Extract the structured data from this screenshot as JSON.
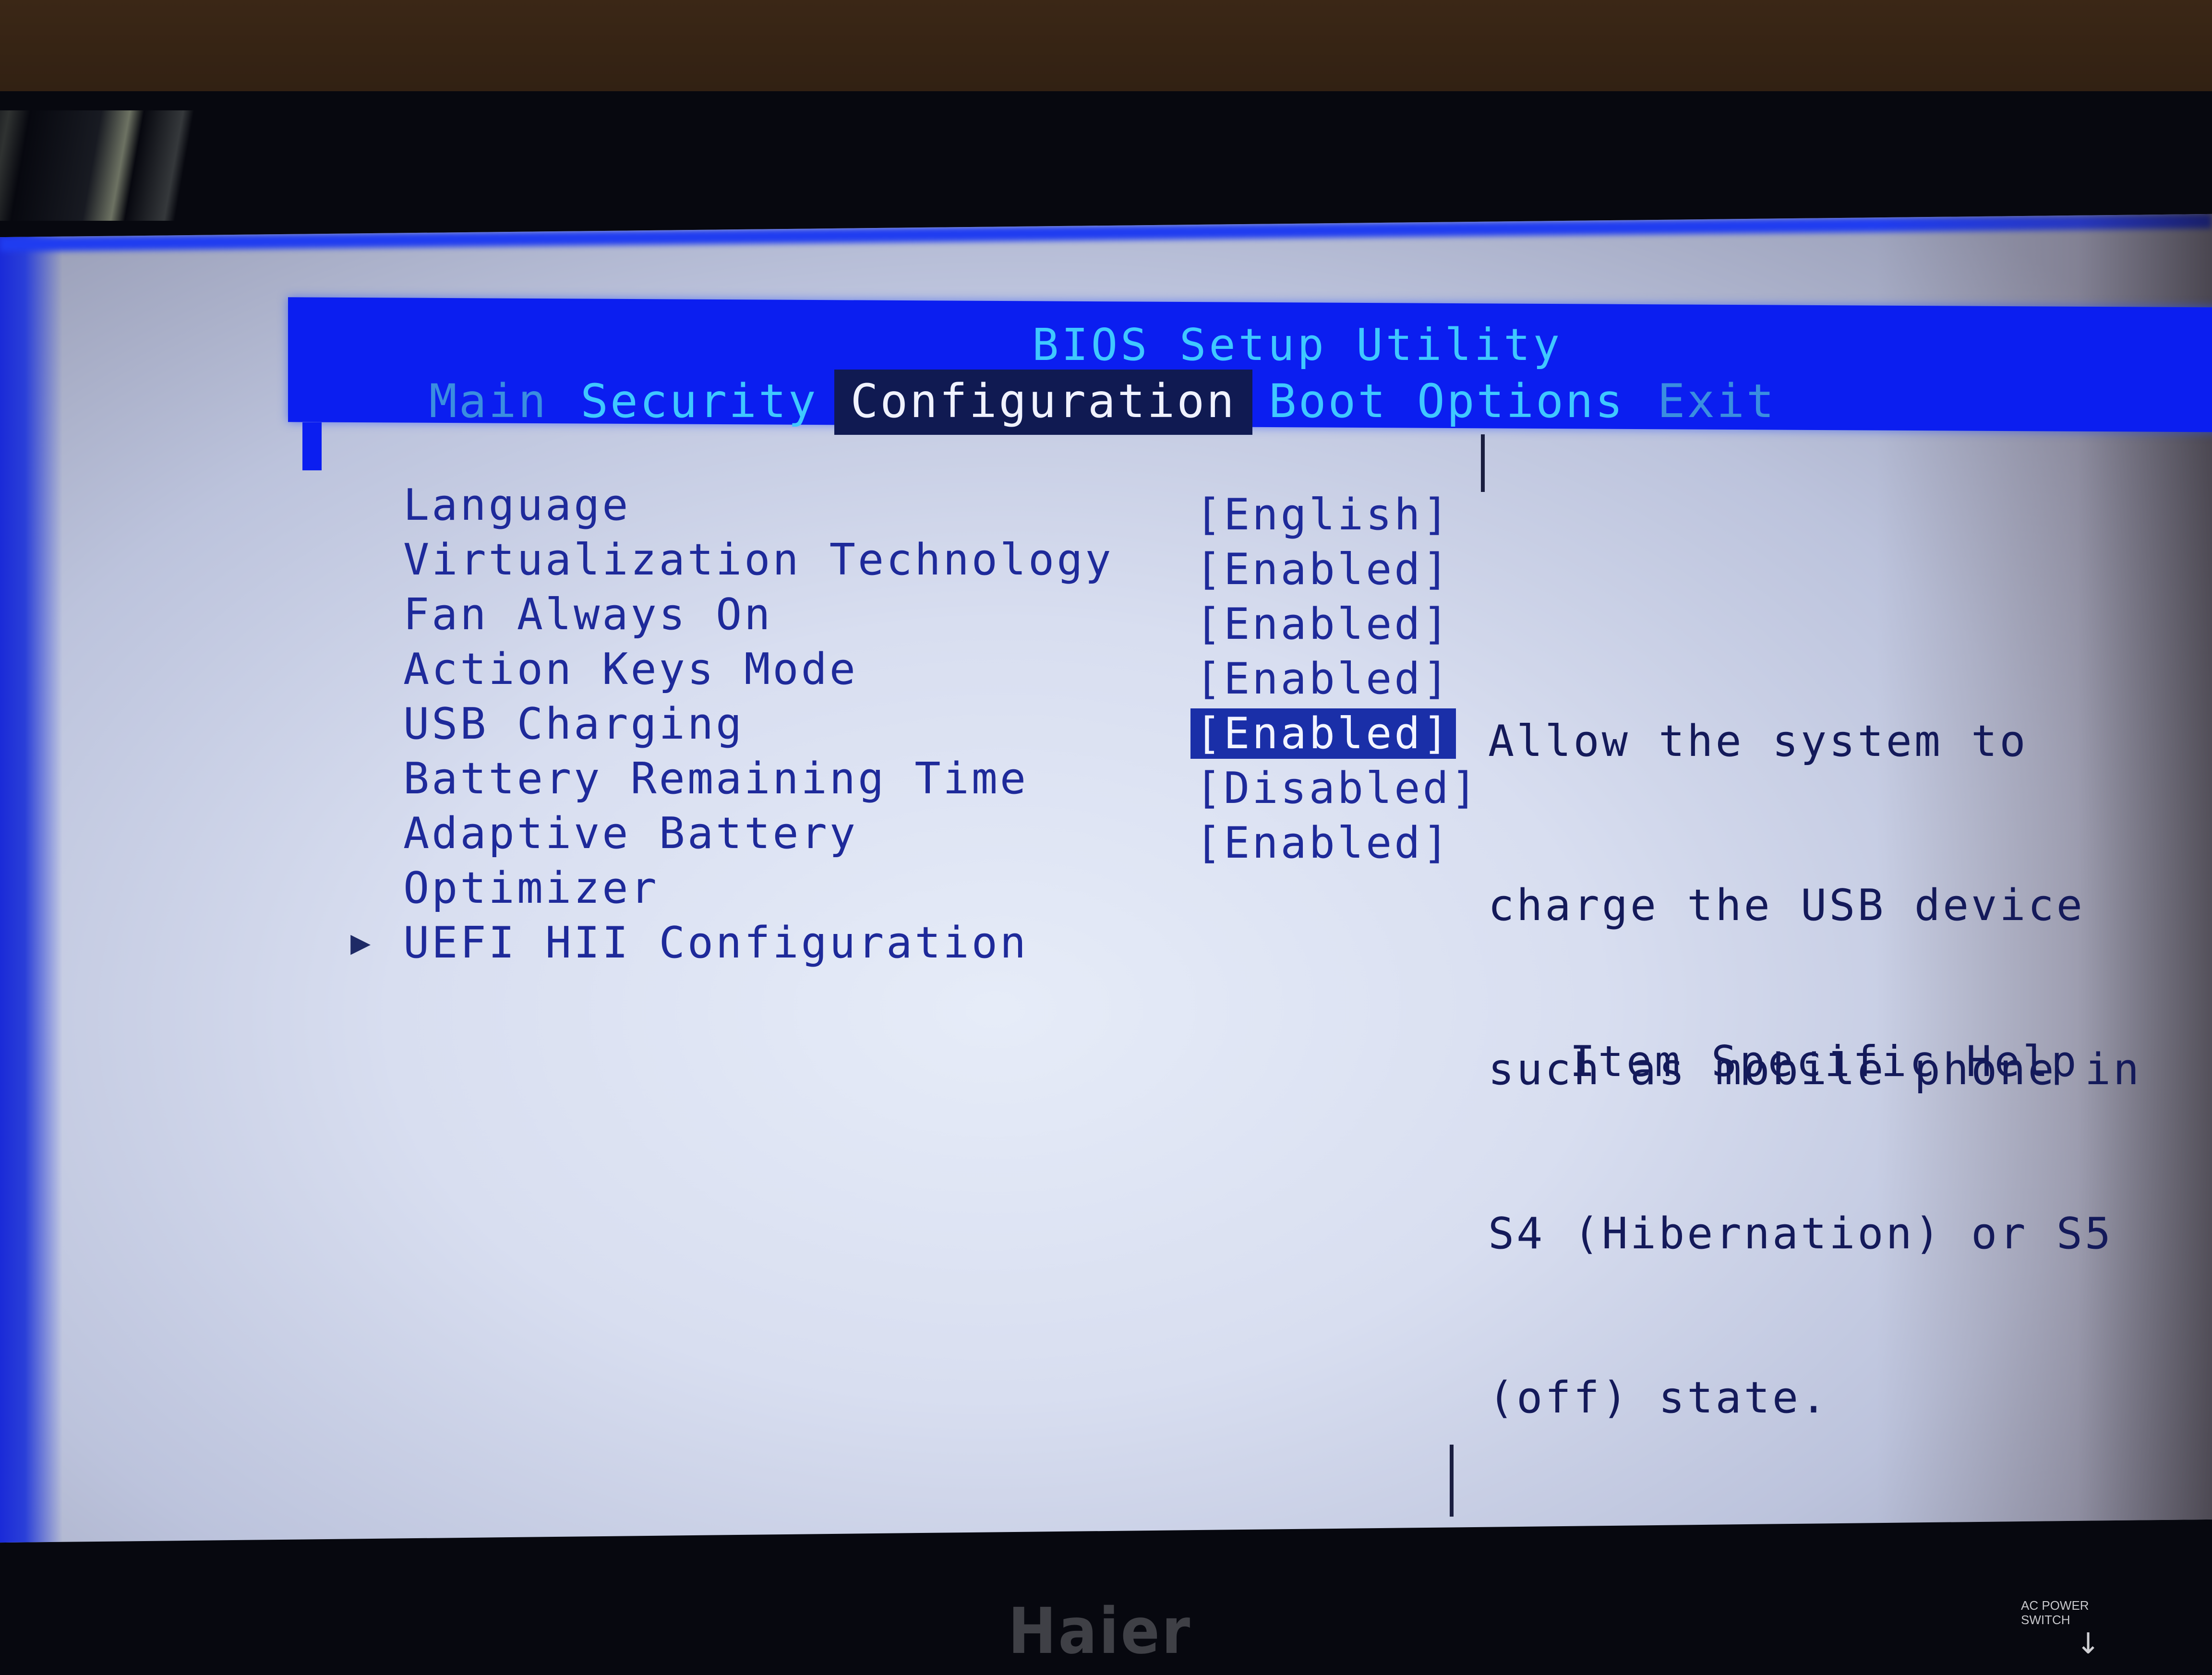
{
  "bios": {
    "title": "BIOS Setup Utility",
    "tabs": [
      {
        "label": "Main",
        "state": "dim"
      },
      {
        "label": "Security",
        "state": "normal"
      },
      {
        "label": "Configuration",
        "state": "selected"
      },
      {
        "label": "Boot Options",
        "state": "normal"
      },
      {
        "label": "Exit",
        "state": "dim"
      }
    ],
    "settings": [
      {
        "label": "Language",
        "value": "[English]"
      },
      {
        "label": "Virtualization Technology",
        "value": "[Enabled]"
      },
      {
        "label": "Fan Always On",
        "value": "[Enabled]"
      },
      {
        "label": "Action Keys Mode",
        "value": "[Enabled]"
      },
      {
        "label": "USB Charging",
        "value": "[Enabled]",
        "selected": true
      },
      {
        "label": "Battery Remaining Time",
        "value": "[Disabled]"
      },
      {
        "label": "Adaptive Battery",
        "value": "[Enabled]"
      },
      {
        "label": "Optimizer",
        "value": ""
      },
      {
        "label": "UEFI HII Configuration",
        "value": "",
        "submenu": true
      }
    ],
    "submenu_icon": "triangle-right",
    "help": {
      "lines": [
        "Allow the system to",
        "charge the USB device",
        "such as mobile phone in",
        "S4 (Hibernation) or S5",
        "(off) state."
      ],
      "title": "Item Specific Help"
    },
    "colors": {
      "header_bg": "#0b1ef0",
      "title_text": "#3fc8ff",
      "selected_tab_bg": "#101a52",
      "body_bg": "#dfe5f4",
      "body_text": "#1e2a9a",
      "selected_value_bg": "#1a2fa8"
    }
  },
  "monitor": {
    "brand": "Haier",
    "ac_power_label_1": "AC POWER",
    "ac_power_label_2": "SWITCH"
  }
}
